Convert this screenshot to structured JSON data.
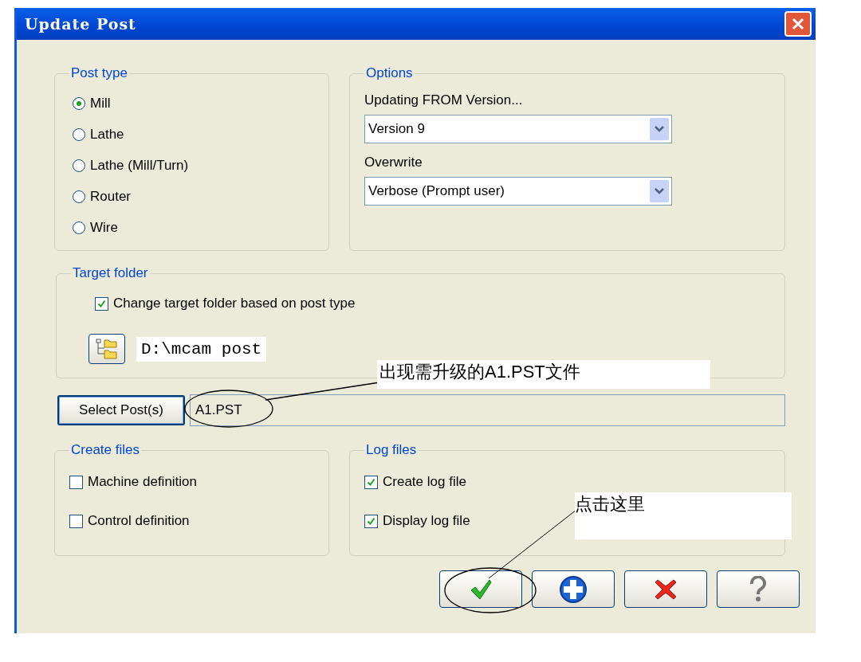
{
  "window": {
    "title": "Update Post"
  },
  "post_type": {
    "title": "Post type",
    "options": [
      {
        "label": "Mill",
        "selected": true
      },
      {
        "label": "Lathe",
        "selected": false
      },
      {
        "label": "Lathe (Mill/Turn)",
        "selected": false
      },
      {
        "label": "Router",
        "selected": false
      },
      {
        "label": "Wire",
        "selected": false
      }
    ]
  },
  "options": {
    "title": "Options",
    "from_label": "Updating FROM Version...",
    "from_value": "Version 9",
    "overwrite_label": "Overwrite",
    "overwrite_value": "Verbose (Prompt user)"
  },
  "target_folder": {
    "title": "Target folder",
    "change_folder": {
      "label": "Change target folder based on post type",
      "checked": true
    },
    "path": "D:\\mcam post"
  },
  "select_posts": {
    "button": "Select Post(s)",
    "value": "A1.PST"
  },
  "create_files": {
    "title": "Create files",
    "items": [
      {
        "label": "Machine definition",
        "checked": false
      },
      {
        "label": "Control definition",
        "checked": false
      }
    ]
  },
  "log_files": {
    "title": "Log files",
    "items": [
      {
        "label": "Create log file",
        "checked": true
      },
      {
        "label": "Display log file",
        "checked": true
      }
    ]
  },
  "buttons": [
    {
      "kind": "ok"
    },
    {
      "kind": "add"
    },
    {
      "kind": "cancel"
    },
    {
      "kind": "help"
    }
  ],
  "annotations": [
    {
      "text": "出现需升级的A1.PST文件"
    },
    {
      "text": "点击这里"
    }
  ]
}
